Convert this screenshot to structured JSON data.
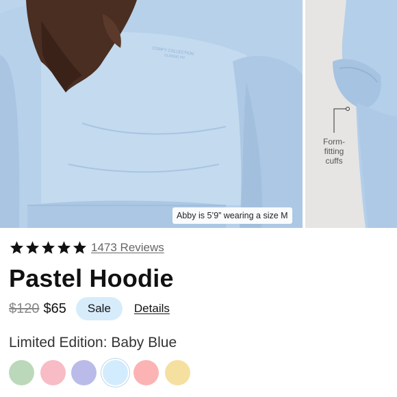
{
  "gallery": {
    "side_label_lines": [
      "Form-",
      "fitting",
      "cuffs"
    ],
    "model_caption": "Abby is 5’9” wearing a size M"
  },
  "rating": {
    "stars": 5,
    "reviews_text": "1473 Reviews"
  },
  "product": {
    "title": "Pastel Hoodie",
    "original_price": "$120",
    "sale_price": "$65",
    "sale_badge": "Sale",
    "details_link": "Details",
    "variant_label": "Limited Edition: Baby Blue"
  },
  "swatches": [
    {
      "color": "#bcd8bb",
      "selected": false
    },
    {
      "color": "#f8bcc6",
      "selected": false
    },
    {
      "color": "#babbe8",
      "selected": false
    },
    {
      "color": "#d3ecfd",
      "selected": true
    },
    {
      "color": "#fcb3b4",
      "selected": false
    },
    {
      "color": "#f6e0a0",
      "selected": false
    }
  ],
  "colors": {
    "sale_pill": "#d6ecfb",
    "hoodie": "#b6d1ea"
  }
}
